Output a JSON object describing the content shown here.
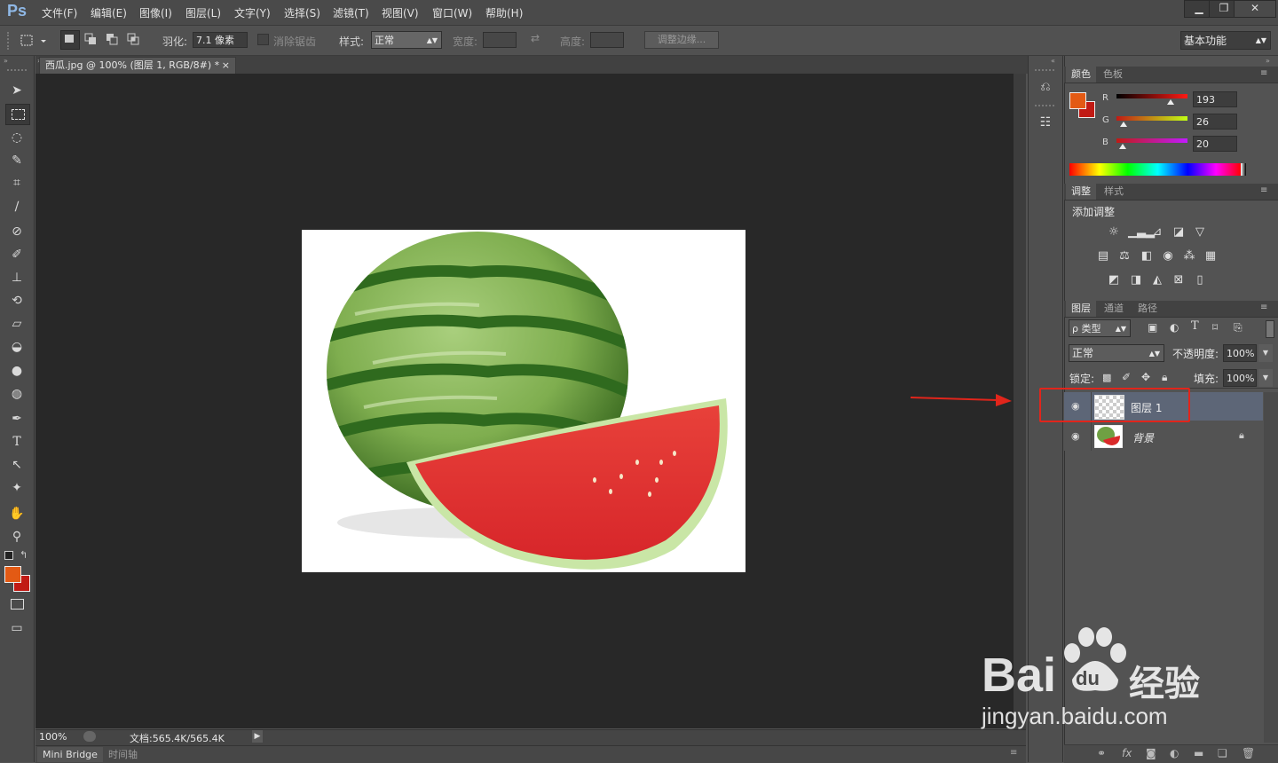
{
  "app": {
    "logo": "Ps"
  },
  "menu": [
    "文件(F)",
    "编辑(E)",
    "图像(I)",
    "图层(L)",
    "文字(Y)",
    "选择(S)",
    "滤镜(T)",
    "视图(V)",
    "窗口(W)",
    "帮助(H)"
  ],
  "window_controls": {
    "minimize": "▁",
    "restore": "❐",
    "close": "✕"
  },
  "options": {
    "feather_label": "羽化:",
    "feather_value": "7.1 像素",
    "antialias_label": "消除锯齿",
    "style_label": "样式:",
    "style_value": "正常",
    "width_label": "宽度:",
    "height_label": "高度:",
    "refine_edge": "调整边缘...",
    "workspace": "基本功能"
  },
  "document": {
    "tab_title": "西瓜.jpg @ 100% (图层 1, RGB/8#) *",
    "close": "×",
    "zoom": "100%",
    "doc_info": "文档:565.4K/565.4K"
  },
  "bottom_tabs": [
    "Mini Bridge",
    "时间轴"
  ],
  "color_panel": {
    "tabs": [
      "颜色",
      "色板"
    ],
    "channels": [
      {
        "label": "R",
        "value": "193"
      },
      {
        "label": "G",
        "value": "26"
      },
      {
        "label": "B",
        "value": "20"
      }
    ],
    "fg_color": "#e35a14",
    "bg_color": "#c11a14"
  },
  "adjust_panel": {
    "tabs": [
      "调整",
      "样式"
    ],
    "title": "添加调整",
    "icon_rows": [
      [
        "brightness-icon",
        "levels-icon",
        "curves-icon",
        "exposure-icon",
        "vibrance-icon"
      ],
      [
        "hue-saturation-icon",
        "color-balance-icon",
        "black-white-icon",
        "photo-filter-icon",
        "channel-mixer-icon",
        "color-lookup-icon"
      ],
      [
        "invert-icon",
        "posterize-icon",
        "threshold-icon",
        "selective-color-icon",
        "gradient-map-icon"
      ]
    ]
  },
  "layers_panel": {
    "tabs": [
      "图层",
      "通道",
      "路径"
    ],
    "filter_label": "ρ 类型",
    "blend_mode": "正常",
    "opacity_label": "不透明度:",
    "opacity_value": "100%",
    "lock_label": "锁定:",
    "fill_label": "填充:",
    "fill_value": "100%",
    "layers": [
      {
        "name": "图层 1",
        "selected": true
      },
      {
        "name": "背景",
        "selected": false
      }
    ]
  },
  "watermark": {
    "brand": "Bai",
    "brand2": "du",
    "site_cn": "经验",
    "url": "jingyan.baidu.com"
  }
}
